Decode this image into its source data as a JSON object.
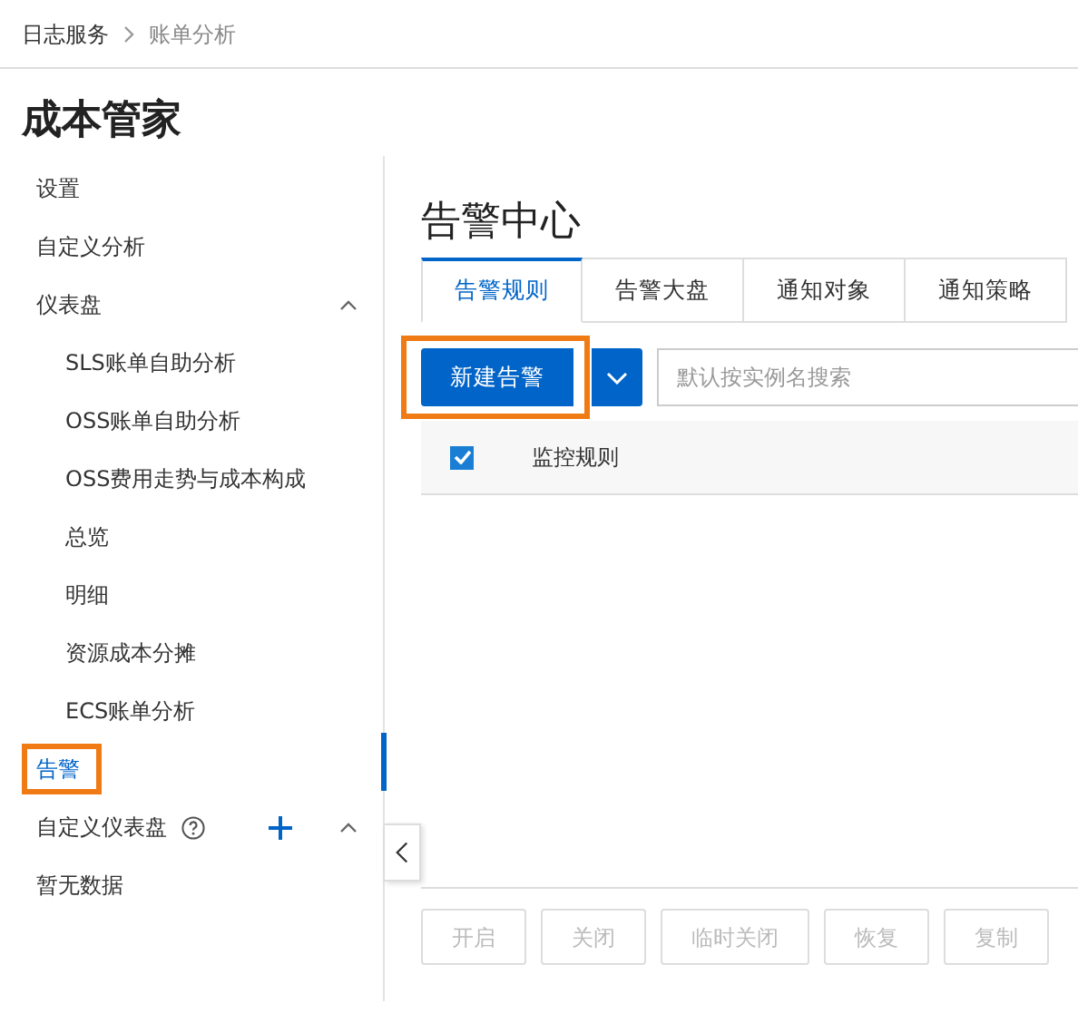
{
  "breadcrumb": [
    {
      "label": "日志服务",
      "current": false
    },
    {
      "label": "账单分析",
      "current": true
    }
  ],
  "page_title": "成本管家",
  "sidebar": {
    "items": [
      {
        "label": "设置",
        "selected": false,
        "highlighted": false
      },
      {
        "label": "自定义分析",
        "selected": false,
        "highlighted": false
      },
      {
        "label": "仪表盘",
        "selected": false,
        "highlighted": false,
        "expanded": true,
        "children": [
          {
            "label": "SLS账单自助分析",
            "selected": false,
            "highlighted": false
          },
          {
            "label": "OSS账单自助分析",
            "selected": false,
            "highlighted": false
          },
          {
            "label": "OSS费用走势与成本构成",
            "selected": false,
            "highlighted": false
          },
          {
            "label": "总览",
            "selected": false,
            "highlighted": false
          },
          {
            "label": "明细",
            "selected": false,
            "highlighted": false
          },
          {
            "label": "资源成本分摊",
            "selected": false,
            "highlighted": false
          },
          {
            "label": "ECS账单分析",
            "selected": false,
            "highlighted": false
          }
        ]
      },
      {
        "label": "告警",
        "selected": true,
        "highlighted": true
      },
      {
        "label": "自定义仪表盘",
        "selected": false,
        "highlighted": false,
        "expanded": true,
        "help": true,
        "addable": true,
        "children": [
          {
            "label": "暂无数据",
            "selected": false,
            "highlighted": false,
            "kind": "empty"
          }
        ]
      }
    ]
  },
  "main": {
    "title": "告警中心",
    "tabs": [
      {
        "label": "告警规则",
        "selected": true
      },
      {
        "label": "告警大盘",
        "selected": false
      },
      {
        "label": "通知对象",
        "selected": false
      },
      {
        "label": "通知策略",
        "selected": false
      }
    ],
    "create_button": {
      "label": "新建告警",
      "highlighted": true
    },
    "search": {
      "placeholder": "默认按实例名搜索"
    },
    "table": {
      "select_all_checked": true,
      "columns": [
        "监控规则"
      ]
    },
    "actions": [
      {
        "label": "开启",
        "disabled": true
      },
      {
        "label": "关闭",
        "disabled": true
      },
      {
        "label": "临时关闭",
        "disabled": true
      },
      {
        "label": "恢复",
        "disabled": true
      },
      {
        "label": "复制",
        "disabled": true
      }
    ]
  }
}
